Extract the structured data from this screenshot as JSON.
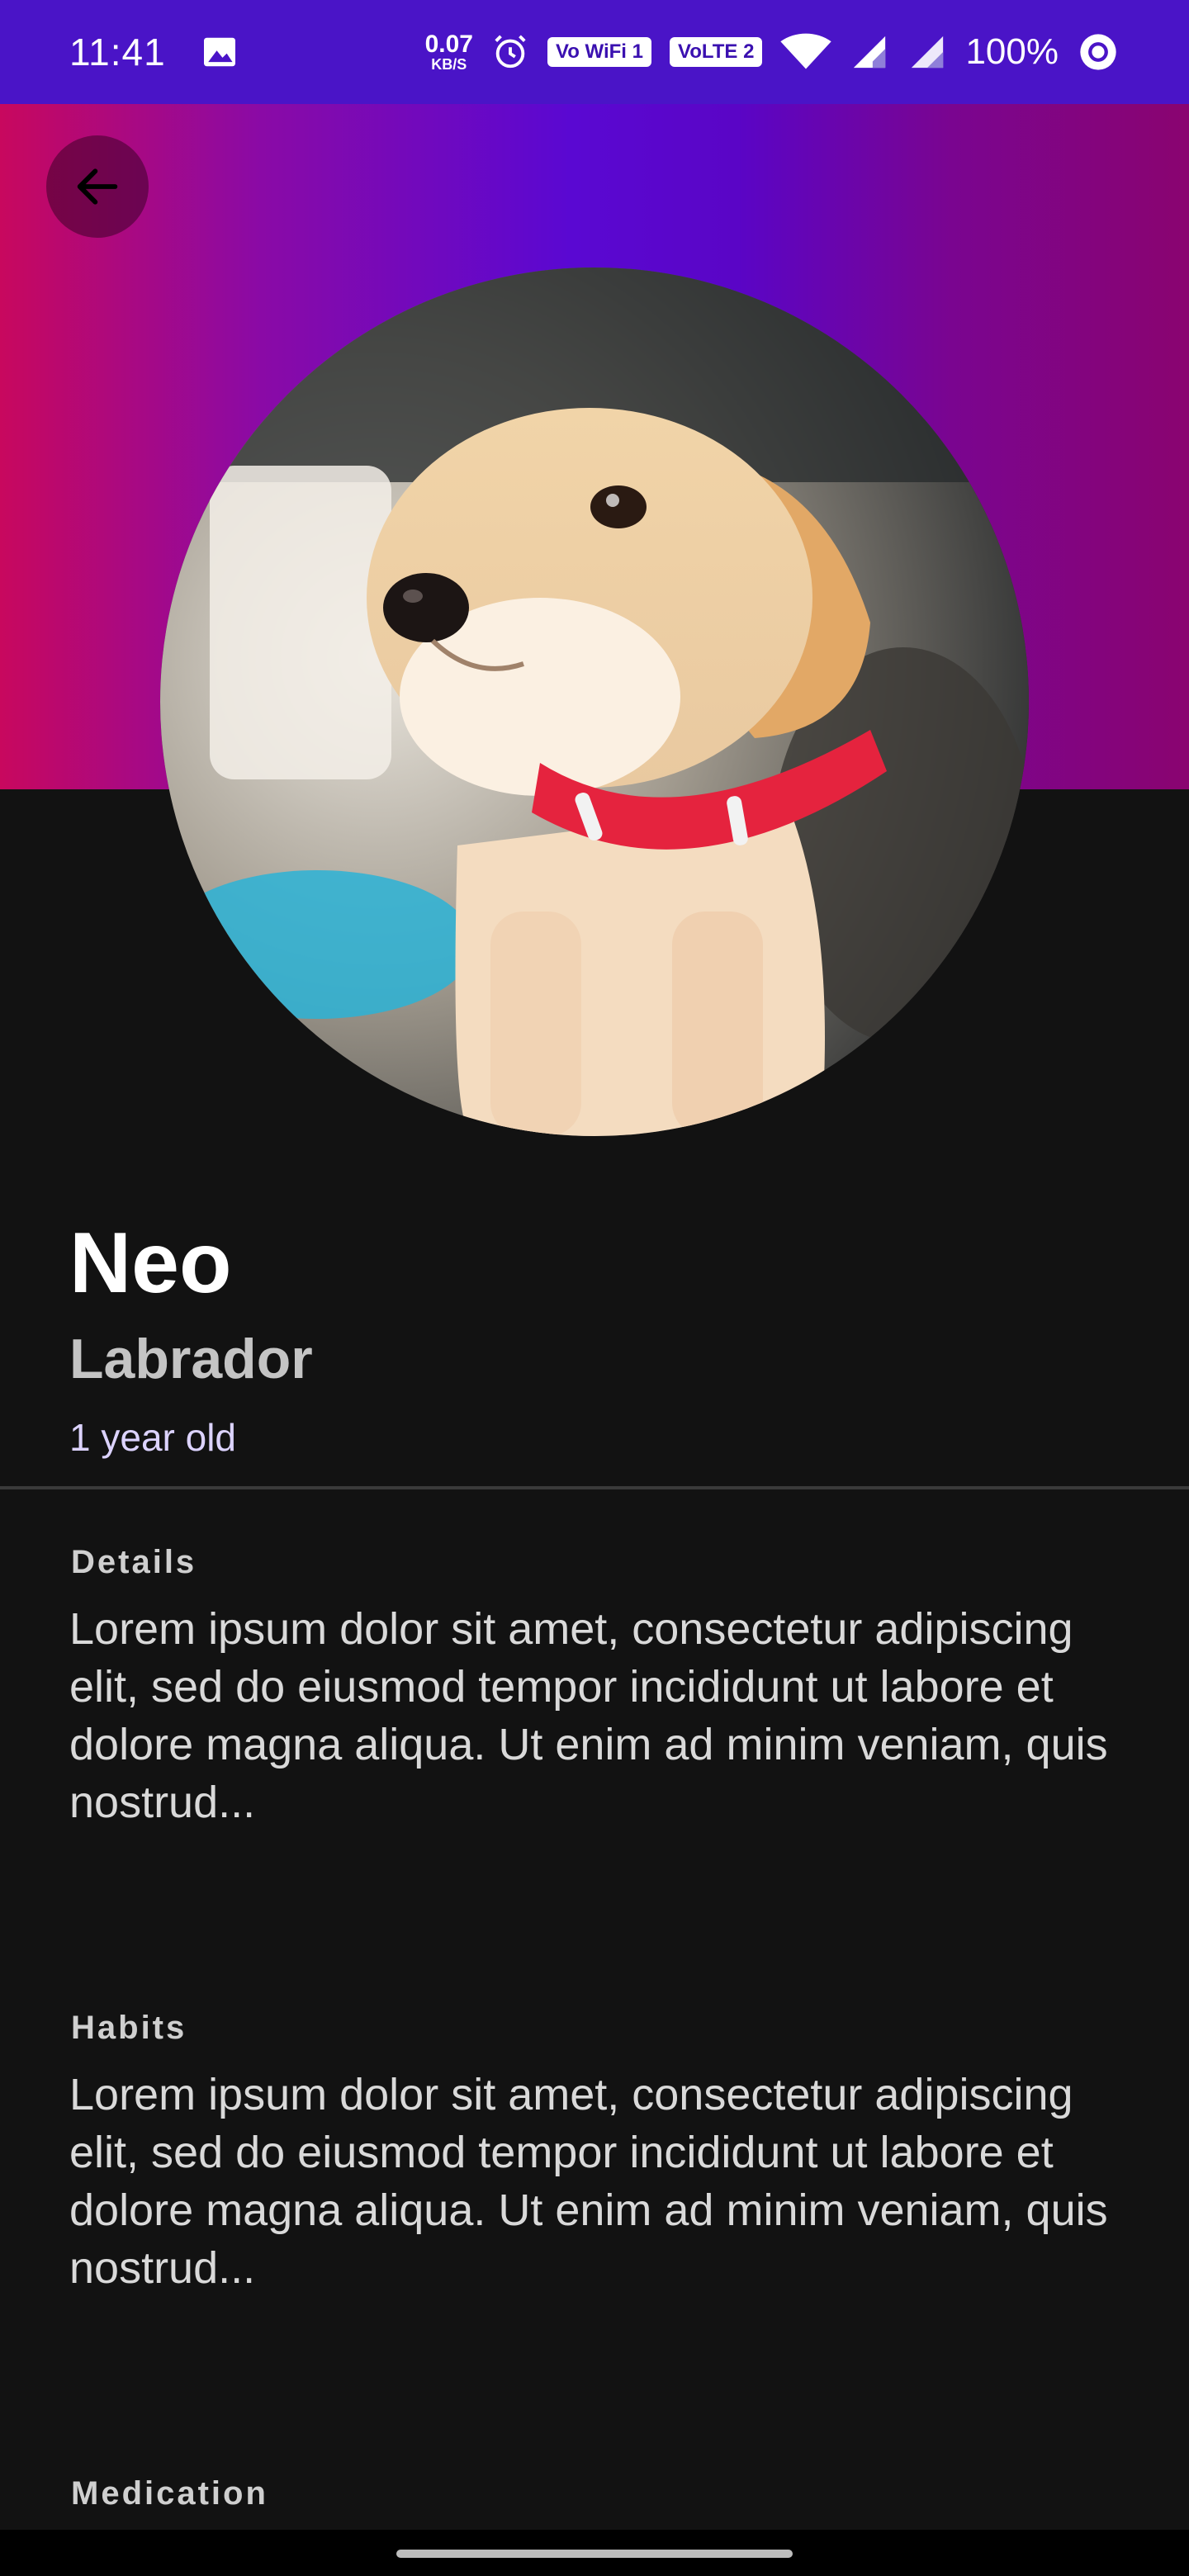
{
  "status_bar": {
    "time": "11:41",
    "net_speed_value": "0.07",
    "net_speed_unit": "KB/S",
    "sim1_label": "Vo WiFi 1",
    "sim2_label": "VoLTE 2",
    "battery": "100%"
  },
  "pet": {
    "name": "Neo",
    "breed": "Labrador",
    "age": "1 year old"
  },
  "sections": [
    {
      "title": "Details",
      "body": "Lorem ipsum dolor sit amet, consectetur adipiscing elit, sed do eiusmod tempor incididunt ut labore et dolore magna aliqua. Ut enim ad minim veniam, quis nostrud..."
    },
    {
      "title": "Habits",
      "body": "Lorem ipsum dolor sit amet, consectetur adipiscing elit, sed do eiusmod tempor incididunt ut labore et dolore magna aliqua. Ut enim ad minim veniam, quis nostrud..."
    },
    {
      "title": "Medication",
      "body": ""
    }
  ],
  "colors": {
    "status_bar": "#4a14c7",
    "background": "#121212",
    "age_accent": "#dcd3ff"
  },
  "icons": {
    "back": "arrow-left-icon",
    "gallery": "image-icon",
    "alarm": "alarm-icon",
    "wifi": "wifi-icon",
    "signal": "signal-icon",
    "battery_status": "circle-icon"
  }
}
